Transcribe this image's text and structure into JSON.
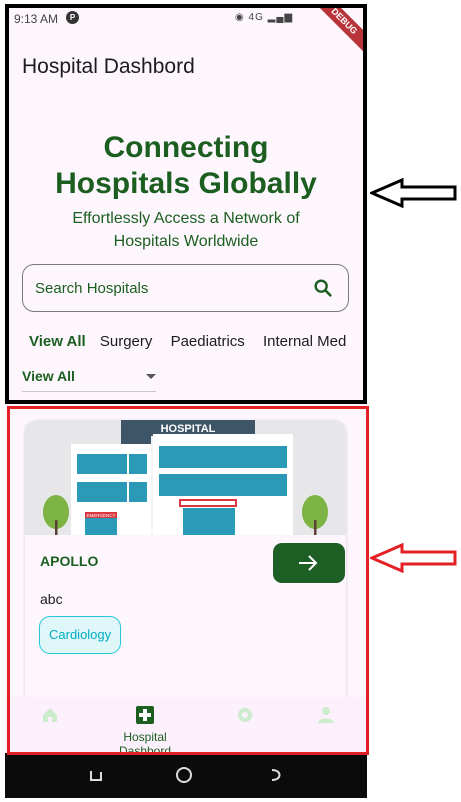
{
  "status_bar": {
    "time": "9:13 AM",
    "icons_text": "4G",
    "debug_label": "DEBUG"
  },
  "app_bar": {
    "title": "Hospital Dashbord"
  },
  "hero": {
    "title_line1": "Connecting",
    "title_line2": "Hospitals Globally",
    "subtitle_line1": "Effortlessly Access a Network of",
    "subtitle_line2": "Hospitals Worldwide"
  },
  "search": {
    "placeholder": "Search Hospitals",
    "icon": "search-icon"
  },
  "filter_chips": [
    "View All",
    "Surgery",
    "Paediatrics",
    "Internal Med"
  ],
  "dropdown": {
    "selected": "View All"
  },
  "hospital_card": {
    "image_sign": "HOSPITAL",
    "image_small_sign": "EMERGENCY",
    "name": "APOLLO",
    "description": "abc",
    "specialty": "Cardiology",
    "action_icon": "arrow-right-icon"
  },
  "bottom_nav": {
    "items": [
      {
        "icon": "home-icon"
      },
      {
        "icon": "hospital-plus-icon",
        "label": "Hospital Dashbord"
      },
      {
        "icon": "gear-icon"
      },
      {
        "icon": "person-icon"
      }
    ]
  },
  "colors": {
    "primary": "#1b5e20",
    "button": "#1e5f25",
    "tag_border": "#26c6da",
    "tag_bg": "#e0f7fa",
    "annotation_black": "#000000",
    "annotation_red": "#e32026"
  }
}
